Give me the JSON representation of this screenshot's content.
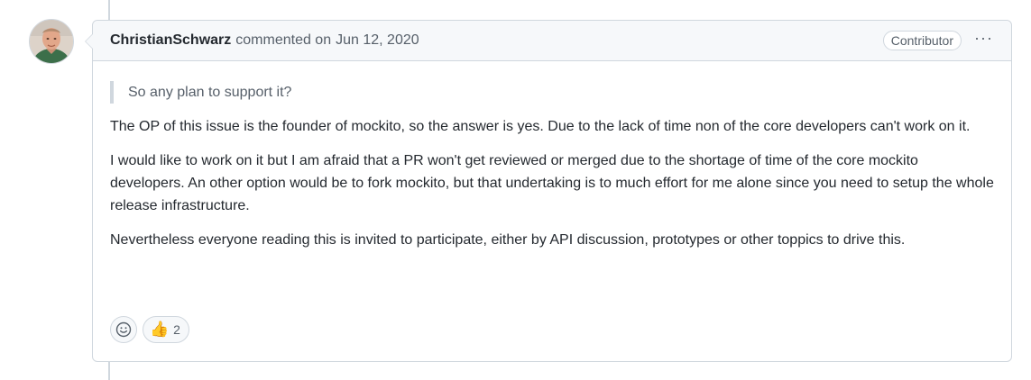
{
  "comment": {
    "author": "ChristianSchwarz",
    "action": "commented on",
    "date": "Jun 12, 2020",
    "role_badge": "Contributor",
    "menu_icon": "kebab-horizontal-icon",
    "quote": "So any plan to support it?",
    "paragraphs": [
      "The OP of this issue is the founder of mockito, so the answer is yes. Due to the lack of time non of the core developers can't work on it.",
      "I would like to work on it but I am afraid that a PR won't get reviewed or merged due to the shortage of time of the core mockito developers. An other option would be to fork mockito, but that undertaking is to much effort for me alone since you need to setup the whole release infrastructure.",
      "Nevertheless everyone reading this is invited to participate, either by API discussion, prototypes or other toppics to drive this."
    ]
  },
  "reactions": {
    "add_icon": "smiley-icon",
    "items": [
      {
        "emoji": "👍",
        "count": "2"
      }
    ]
  },
  "colors": {
    "border": "#d0d7de",
    "header_bg": "#f6f8fa",
    "text": "#24292f",
    "muted": "#57606a"
  }
}
